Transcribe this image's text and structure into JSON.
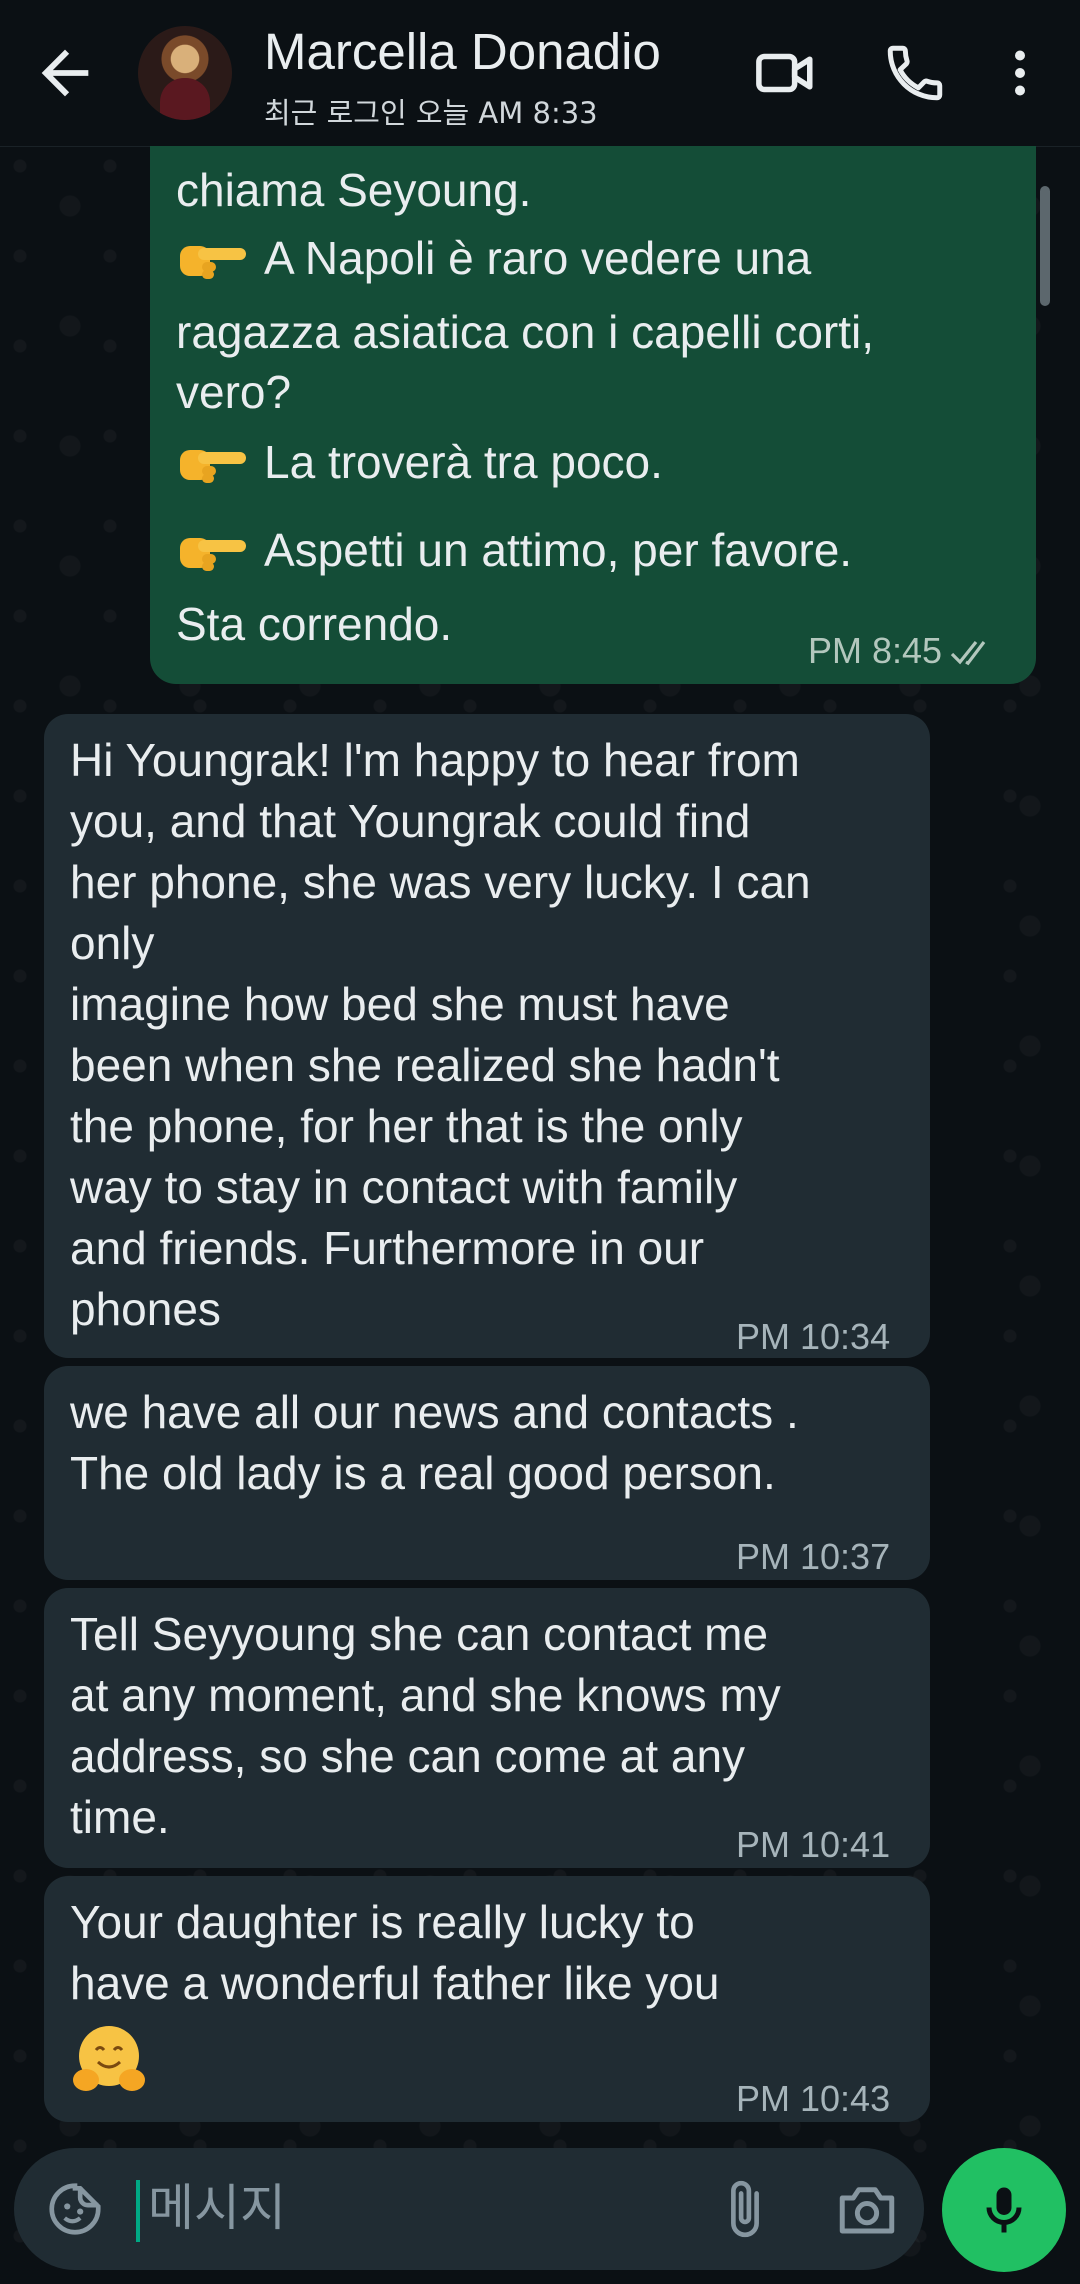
{
  "colors": {
    "header_bg": "#0b1014",
    "outgoing_bubble": "#144d37",
    "incoming_bubble": "#202c33",
    "accent": "#21c063"
  },
  "header": {
    "contact_name": "Marcella Donadio",
    "last_seen": "최근 로그인 오늘 AM 8:33",
    "icons": [
      "back-arrow-icon",
      "video-call-icon",
      "phone-icon",
      "more-vert-icon"
    ]
  },
  "messages": [
    {
      "direction": "outgoing",
      "lines": [
        "chiama Seyoung.",
        "A Napoli è raro vedere una",
        "ragazza asiatica con i capelli corti,",
        "vero?",
        "La troverà tra poco.",
        "Aspetti un attimo, per favore.",
        "Sta correndo."
      ],
      "time": "PM 8:45",
      "status": "read-double-check"
    },
    {
      "direction": "incoming",
      "lines": [
        "Hi Youngrak! l'm happy to hear from",
        "you, and that Youngrak could find",
        "her phone, she was very lucky. I can",
        "only",
        "imagine how bed she must have",
        "been when she realized she hadn't",
        "the phone, for her that is the only",
        "way to stay in contact  with family",
        "and friends. Furthermore in our",
        "phones"
      ],
      "time": "PM 10:34"
    },
    {
      "direction": "incoming",
      "lines": [
        "we have all our news and contacts .",
        "The old lady is a real good person."
      ],
      "time": "PM 10:37"
    },
    {
      "direction": "incoming",
      "lines": [
        "Tell Seyyoung she can contact me",
        "at any moment, and she knows my",
        "address, so she can come at any",
        "time."
      ],
      "time": "PM 10:41"
    },
    {
      "direction": "incoming",
      "lines": [
        "Your daughter is really  lucky to",
        "have a  wonderful father like you"
      ],
      "emoji": "hugging-face-emoji",
      "time": "PM 10:43"
    }
  ],
  "composer": {
    "placeholder": "메시지",
    "icons": [
      "sticker-icon",
      "attach-icon",
      "camera-icon",
      "mic-icon"
    ]
  }
}
